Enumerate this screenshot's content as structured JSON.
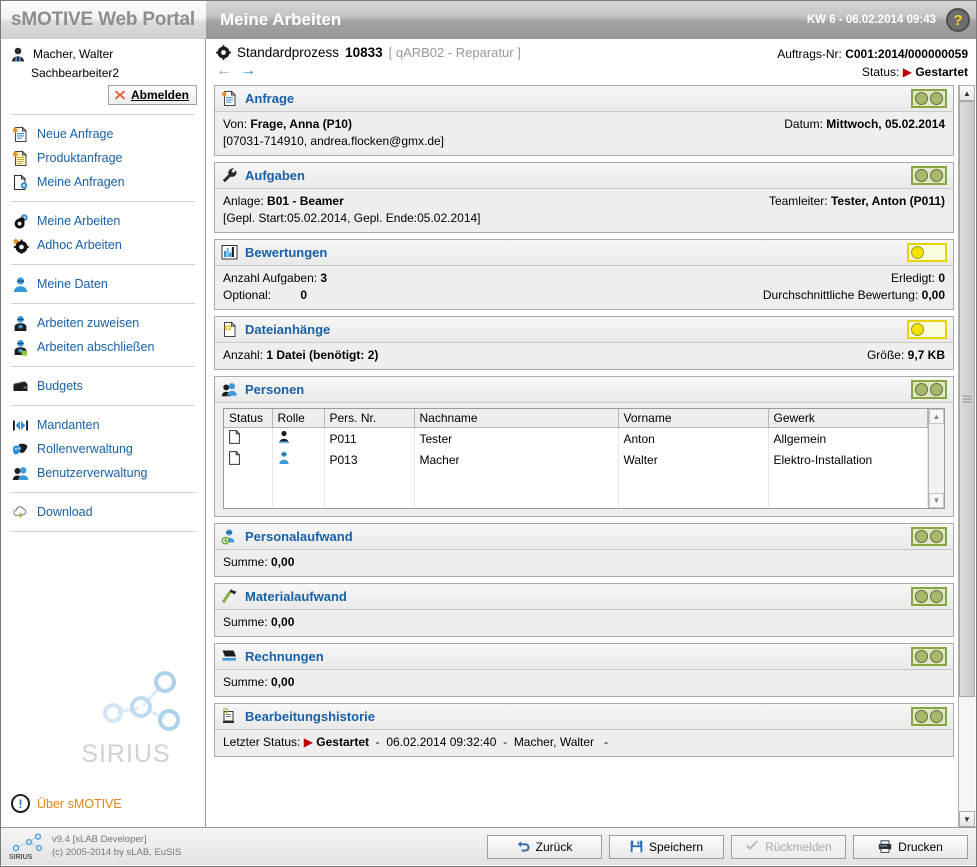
{
  "header": {
    "brand": "sMOTIVE Web Portal",
    "page_title": "Meine Arbeiten",
    "kw_datetime": "KW 6 - 06.02.2014 09:43",
    "help_glyph": "?"
  },
  "sidebar": {
    "user_name": "Macher, Walter",
    "user_role": "Sachbearbeiter2",
    "logout_label": "Abmelden",
    "groups": [
      {
        "items": [
          {
            "label": "Neue Anfrage",
            "icon": "new-request-icon"
          },
          {
            "label": "Produktanfrage",
            "icon": "product-request-icon"
          },
          {
            "label": "Meine Anfragen",
            "icon": "my-requests-icon"
          }
        ]
      },
      {
        "items": [
          {
            "label": "Meine Arbeiten",
            "icon": "my-works-gear-icon"
          },
          {
            "label": "Adhoc Arbeiten",
            "icon": "adhoc-works-gear-icon"
          }
        ]
      },
      {
        "items": [
          {
            "label": "Meine Daten",
            "icon": "my-data-person-icon"
          }
        ]
      },
      {
        "items": [
          {
            "label": "Arbeiten zuweisen",
            "icon": "assign-works-icon"
          },
          {
            "label": "Arbeiten abschließen",
            "icon": "complete-works-icon"
          }
        ]
      },
      {
        "items": [
          {
            "label": "Budgets",
            "icon": "budget-wallet-icon"
          }
        ]
      },
      {
        "items": [
          {
            "label": "Mandanten",
            "icon": "clients-arrows-icon"
          },
          {
            "label": "Rollenverwaltung",
            "icon": "role-management-masks-icon"
          },
          {
            "label": "Benutzerverwaltung",
            "icon": "user-management-icon"
          }
        ]
      },
      {
        "items": [
          {
            "label": "Download",
            "icon": "download-cloud-icon"
          }
        ]
      }
    ],
    "watermark": "SIRIUS",
    "about_label": "Über sMOTIVE"
  },
  "process": {
    "type_label": "Standardprozess",
    "number": "10833",
    "tag": "[ qARB02 - Reparatur ]",
    "order_label": "Auftrags-Nr:",
    "order_value": "C001:2014/000000059",
    "status_label": "Status:",
    "status_value": "Gestartet",
    "status_color": "#c00000"
  },
  "panels": [
    {
      "id": "anfrage",
      "title": "Anfrage",
      "icon": "request-document-icon",
      "lights": "green",
      "rows": [
        {
          "left_label": "Von:",
          "left_value": "Frage, Anna (P10)",
          "right_label": "Datum:",
          "right_value": "Mittwoch, 05.02.2014"
        }
      ],
      "sub": "[07031-714910, andrea.flocken@gmx.de]"
    },
    {
      "id": "aufgaben",
      "title": "Aufgaben",
      "icon": "wrench-icon",
      "lights": "green",
      "rows": [
        {
          "left_label": "Anlage:",
          "left_value": "B01 - Beamer",
          "right_label": "Teamleiter:",
          "right_value": "Tester, Anton (P011)"
        }
      ],
      "sub": "[Gepl. Start:05.02.2014, Gepl. Ende:05.02.2014]"
    },
    {
      "id": "bewertungen",
      "title": "Bewertungen",
      "icon": "bar-chart-icon",
      "lights": "yellow",
      "rows": [
        {
          "left_label": "Anzahl Aufgaben:",
          "left_value": "3",
          "right_label": "Erledigt:",
          "right_value": "0"
        },
        {
          "left_label": "Optional:",
          "left_value": "0",
          "right_label": "Durchschnittliche Bewertung:",
          "right_value": "0,00"
        }
      ]
    },
    {
      "id": "dateianhaenge",
      "title": "Dateianhänge",
      "icon": "attachment-document-icon",
      "lights": "yellow",
      "rows": [
        {
          "left_label": "Anzahl:",
          "left_value": "1 Datei (benötigt: 2)",
          "right_label": "Größe:",
          "right_value": "9,7 KB"
        }
      ]
    },
    {
      "id": "personen",
      "title": "Personen",
      "icon": "people-icon",
      "lights": "green",
      "table": {
        "columns": [
          "Status",
          "Rolle",
          "Pers. Nr.",
          "Nachname",
          "Vorname",
          "Gewerk"
        ],
        "rows": [
          {
            "status": "doc-icon",
            "rolle": "person-dark-icon",
            "pers_nr": "P011",
            "nachname": "Tester",
            "vorname": "Anton",
            "gewerk": "Allgemein"
          },
          {
            "status": "doc-icon",
            "rolle": "person-blue-icon",
            "pers_nr": "P013",
            "nachname": "Macher",
            "vorname": "Walter",
            "gewerk": "Elektro-Installation"
          }
        ]
      }
    },
    {
      "id": "personalaufwand",
      "title": "Personalaufwand",
      "icon": "person-clock-icon",
      "lights": "green",
      "rows": [
        {
          "left_label": "Summe:",
          "left_value": "0,00",
          "right_label": "",
          "right_value": ""
        }
      ]
    },
    {
      "id": "materialaufwand",
      "title": "Materialaufwand",
      "icon": "hammer-icon",
      "lights": "green",
      "rows": [
        {
          "left_label": "Summe:",
          "left_value": "0,00",
          "right_label": "",
          "right_value": ""
        }
      ]
    },
    {
      "id": "rechnungen",
      "title": "Rechnungen",
      "icon": "invoice-icon",
      "lights": "green",
      "rows": [
        {
          "left_label": "Summe:",
          "left_value": "0,00",
          "right_label": "",
          "right_value": ""
        }
      ]
    },
    {
      "id": "bearbeitungshistorie",
      "title": "Bearbeitungshistorie",
      "icon": "scroll-history-icon",
      "lights": "green",
      "history": {
        "label": "Letzter Status:",
        "status": "Gestartet",
        "timestamp": "06.02.2014 09:32:40",
        "user": "Macher, Walter",
        "trailing": "-"
      }
    }
  ],
  "footer": {
    "version": "v9.4 [sLAB Developer]",
    "copyright": "(c) 2005-2014 by sLAB, EuSIS",
    "logo_text": "SIRIUS",
    "buttons": [
      {
        "label": "Zurück",
        "icon": "back-arrow-icon",
        "disabled": false
      },
      {
        "label": "Speichern",
        "icon": "save-disk-icon",
        "disabled": false
      },
      {
        "label": "Rückmelden",
        "icon": "check-icon",
        "disabled": true
      },
      {
        "label": "Drucken",
        "icon": "printer-icon",
        "disabled": false
      }
    ]
  }
}
